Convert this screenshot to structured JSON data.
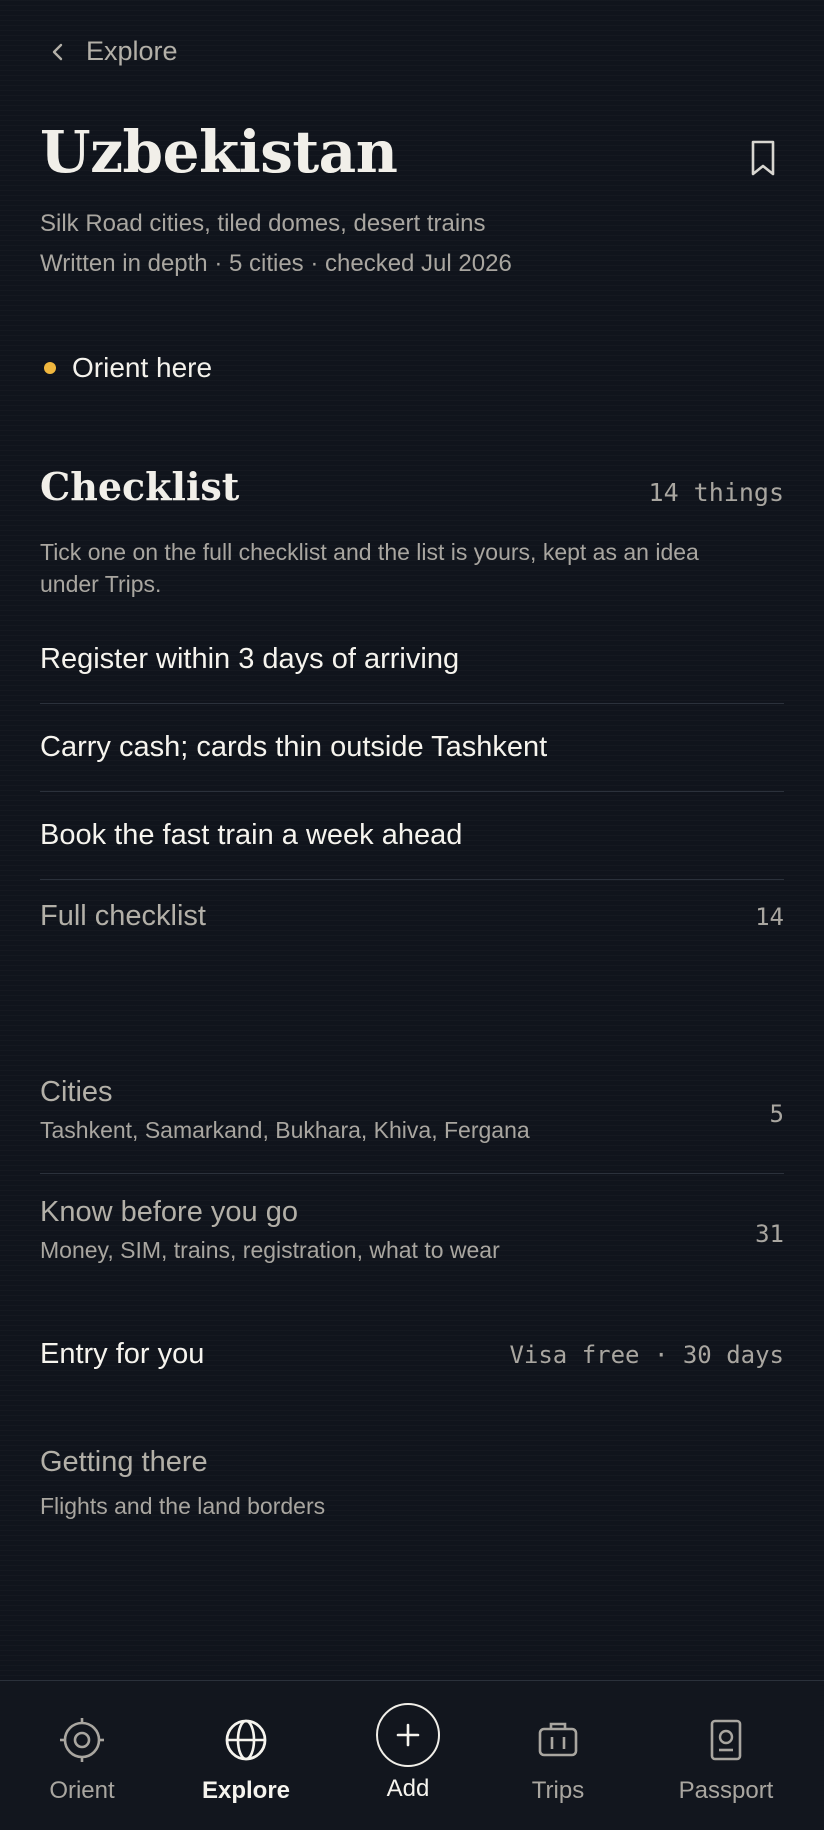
{
  "header": {
    "back_label": "Explore",
    "title": "Uzbekistan",
    "subtitle": "Silk Road cities, tiled domes, desert trains",
    "meta": "Written in depth · 5 cities · checked Jul 2026",
    "bookmark_icon": "bookmark-icon"
  },
  "orient": {
    "label": "Orient here",
    "dot_color": "#f0b73e"
  },
  "checklist": {
    "heading": "Checklist",
    "count": "14 things",
    "description": "Tick one on the full checklist and the list is yours, kept as an idea under Trips.",
    "items": [
      "Register within 3 days of arriving",
      "Carry cash; cards thin outside Tashkent",
      "Book the fast train a week ahead"
    ],
    "full_label": "Full checklist",
    "full_count": "14"
  },
  "sections": {
    "cities": {
      "title": "Cities",
      "subtitle": "Tashkent, Samarkand, Bukhara, Khiva, Fergana",
      "count": "5"
    },
    "know": {
      "title": "Know before you go",
      "subtitle": "Money, SIM, trains, registration, what to wear",
      "count": "31"
    },
    "entry": {
      "title": "Entry for you",
      "value": "Visa free · 30 days"
    },
    "getting": {
      "title": "Getting there",
      "subtitle": "Flights and the land borders"
    }
  },
  "nav": {
    "tabs": [
      {
        "label": "Orient",
        "icon": "target-icon"
      },
      {
        "label": "Explore",
        "icon": "globe-icon",
        "active": true
      },
      {
        "label": "Add",
        "icon": "plus-icon"
      },
      {
        "label": "Trips",
        "icon": "briefcase-icon"
      },
      {
        "label": "Passport",
        "icon": "passport-icon"
      }
    ]
  },
  "colors": {
    "background": "#10141c",
    "accent": "#f0b73e",
    "text": "#f6f4ee",
    "muted": "#a9a6a0"
  }
}
